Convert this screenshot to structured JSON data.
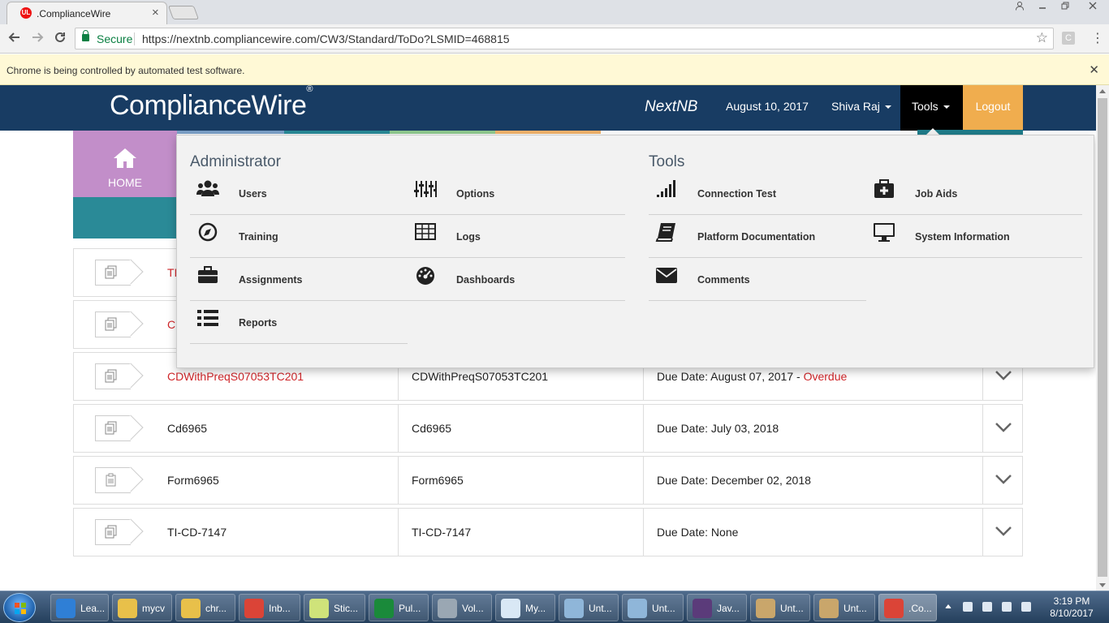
{
  "browser": {
    "tab_title": ".ComplianceWire",
    "tab_close": "×",
    "secure_label": "Secure",
    "url": "https://nextnb.compliancewire.com/CW3/Standard/ToDo?LSMID=468815",
    "ext_label": "C",
    "infobar_text": "Chrome is being controlled by automated test software.",
    "infobar_close": "✕"
  },
  "header": {
    "logo": "ComplianceWire",
    "logo_mark": "®",
    "org": "NextNB",
    "date": "August 10, 2017",
    "user": "Shiva Raj",
    "tools": "Tools",
    "logout": "Logout",
    "colors": {
      "bar": "#183c63",
      "logout": "#f0ad4e"
    }
  },
  "nav": {
    "home_label": "HOME"
  },
  "menu": {
    "admin_title": "Administrator",
    "tools_title": "Tools",
    "admin_items": [
      {
        "label": "Users",
        "icon": "users-icon"
      },
      {
        "label": "Options",
        "icon": "sliders-icon"
      },
      {
        "label": "Training",
        "icon": "compass-icon"
      },
      {
        "label": "Logs",
        "icon": "table-icon"
      },
      {
        "label": "Assignments",
        "icon": "briefcase-icon"
      },
      {
        "label": "Dashboards",
        "icon": "dashboard-icon"
      },
      {
        "label": "Reports",
        "icon": "list-icon"
      }
    ],
    "tools_items": [
      {
        "label": "Connection Test",
        "icon": "signal-icon"
      },
      {
        "label": "Job Aids",
        "icon": "medkit-icon"
      },
      {
        "label": "Platform Documentation",
        "icon": "book-icon"
      },
      {
        "label": "System Information",
        "icon": "monitor-icon"
      },
      {
        "label": "Comments",
        "icon": "envelope-icon"
      }
    ]
  },
  "rows": [
    {
      "name": "TI",
      "code": "",
      "due": "",
      "overdue": "",
      "red": true
    },
    {
      "name": "CD",
      "code": "",
      "due": "",
      "overdue": "",
      "red": true
    },
    {
      "name": "CDWithPreqS07053TC201",
      "code": "CDWithPreqS07053TC201",
      "due": "Due Date: August 07, 2017 - ",
      "overdue": "Overdue",
      "red": true
    },
    {
      "name": "Cd6965",
      "code": "Cd6965",
      "due": "Due Date: July 03, 2018",
      "overdue": "",
      "red": false
    },
    {
      "name": "Form6965",
      "code": "Form6965",
      "due": "Due Date: December 02, 2018",
      "overdue": "",
      "red": false
    },
    {
      "name": "TI-CD-7147",
      "code": "TI-CD-7147",
      "due": "Due Date: None",
      "overdue": "",
      "red": false
    }
  ],
  "taskbar": {
    "items": [
      {
        "label": "Lea...",
        "color": "#2f7fd6"
      },
      {
        "label": "mycv",
        "color": "#e8c04a"
      },
      {
        "label": "chr...",
        "color": "#e8c04a"
      },
      {
        "label": "Inb...",
        "color": "#db4437"
      },
      {
        "label": "Stic...",
        "color": "#cfe37a"
      },
      {
        "label": "Pul...",
        "color": "#1a8a3a"
      },
      {
        "label": "Vol...",
        "color": "#9aa7b3"
      },
      {
        "label": "My...",
        "color": "#d9e8f5"
      },
      {
        "label": "Unt...",
        "color": "#8fb6d9"
      },
      {
        "label": "Unt...",
        "color": "#8fb6d9"
      },
      {
        "label": "Jav...",
        "color": "#5b3b7a"
      },
      {
        "label": "Unt...",
        "color": "#c9a66b"
      },
      {
        "label": "Unt...",
        "color": "#c9a66b"
      },
      {
        "label": ".Co...",
        "color": "#db4437"
      }
    ],
    "time": "3:19 PM",
    "date": "8/10/2017"
  }
}
